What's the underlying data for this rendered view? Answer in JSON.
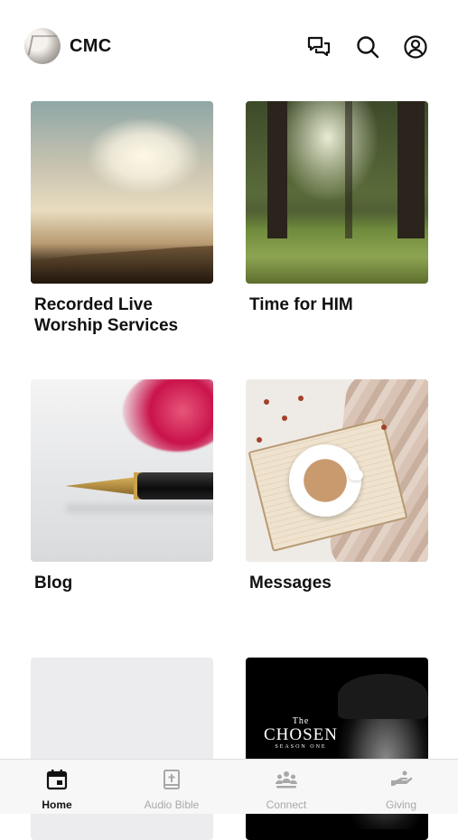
{
  "header": {
    "title": "CMC",
    "avatar_icon": "church-logo-avatar",
    "icons": [
      "chat-icon",
      "search-icon",
      "profile-icon"
    ]
  },
  "grid": {
    "items": [
      {
        "title": "Recorded Live\nWorship Services",
        "image": "sky-clouds-image"
      },
      {
        "title": "Time for HIM",
        "image": "forest-image"
      },
      {
        "title": "Blog",
        "image": "fountain-pen-image"
      },
      {
        "title": "Messages",
        "image": "coffee-book-image"
      },
      {
        "title": "",
        "image": "blank-image"
      },
      {
        "title": "",
        "image": "the-chosen-image"
      }
    ]
  },
  "chosen_poster": {
    "the": "The",
    "main": "CHOSEN",
    "season": "SEASON ONE"
  },
  "tabbar": {
    "active_color": "#111111",
    "inactive_color": "#a8a8a8",
    "tabs": [
      {
        "label": "Home",
        "icon": "calendar-icon",
        "active": true
      },
      {
        "label": "Audio Bible",
        "icon": "bible-icon",
        "active": false
      },
      {
        "label": "Connect",
        "icon": "people-group-icon",
        "active": false
      },
      {
        "label": "Giving",
        "icon": "giving-hand-icon",
        "active": false
      }
    ]
  }
}
